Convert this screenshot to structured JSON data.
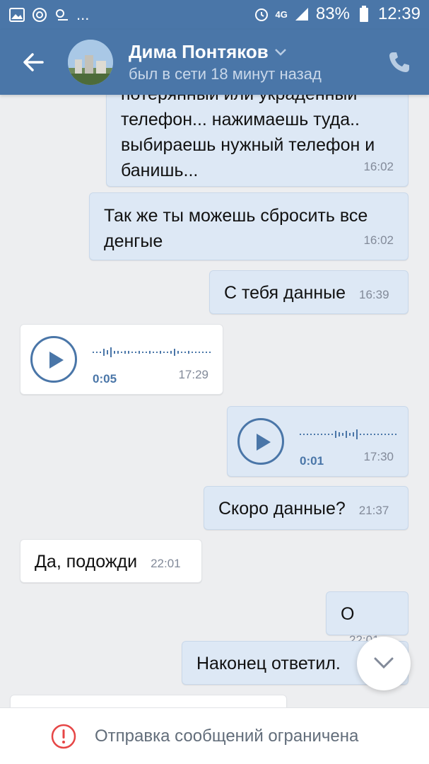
{
  "statusbar": {
    "battery": "83%",
    "time": "12:39",
    "network": "4G",
    "more": "...",
    "icons": [
      "gallery-icon",
      "at-icon",
      "weather-icon",
      "alarm-icon",
      "signal-icon",
      "battery-icon"
    ]
  },
  "header": {
    "name": "Дима Понтяков",
    "status": "был в сети 18 минут назад"
  },
  "messages": [
    {
      "direction": "out",
      "lines": [
        "потерянный или украденный",
        "телефон... нажимаешь туда..",
        "выбираешь нужный телефон и",
        "банишь..."
      ],
      "time": "16:02"
    },
    {
      "direction": "out",
      "lines": [
        "Так же ты можешь сбросить все",
        "денгые"
      ],
      "time": "16:02"
    },
    {
      "direction": "out",
      "text": "С тебя данные",
      "time": "16:39"
    },
    {
      "direction": "in",
      "type": "voice",
      "duration": "0:05",
      "time": "17:29"
    },
    {
      "direction": "out",
      "type": "voice",
      "duration": "0:01",
      "time": "17:30"
    },
    {
      "direction": "out",
      "text": "Скоро данные?",
      "time": "21:37"
    },
    {
      "direction": "in",
      "text": "Да, подожди",
      "time": "22:01"
    },
    {
      "direction": "out",
      "text": "О",
      "time": "22:01"
    },
    {
      "direction": "out",
      "text": "Наконец ответил.",
      "time": ""
    }
  ],
  "bottom": {
    "restriction_text": "Отправка сообщений ограничена"
  },
  "colors": {
    "header": "#4a76a8",
    "outgoing_bubble": "#dde8f5",
    "incoming_bubble": "#ffffff",
    "background": "#edeef0",
    "warning": "#e64646"
  }
}
